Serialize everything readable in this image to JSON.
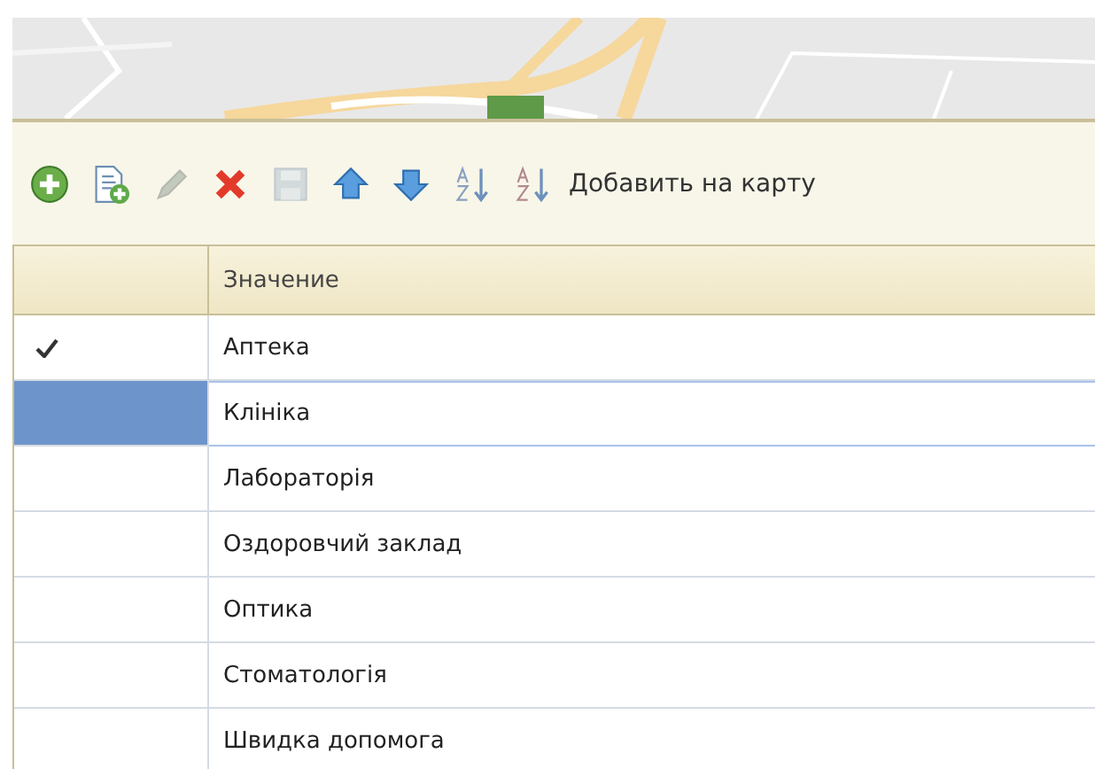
{
  "toolbar": {
    "buttons": [
      {
        "kind": "add",
        "disabled": false
      },
      {
        "kind": "copy",
        "disabled": false
      },
      {
        "kind": "edit",
        "disabled": true
      },
      {
        "kind": "delete",
        "disabled": false
      },
      {
        "kind": "save",
        "disabled": true
      },
      {
        "kind": "up",
        "disabled": false
      },
      {
        "kind": "down",
        "disabled": false
      },
      {
        "kind": "sort-asc",
        "disabled": false
      },
      {
        "kind": "sort-desc",
        "disabled": false
      }
    ],
    "action": "Добавить на карту"
  },
  "table": {
    "columns": [
      "Значение"
    ],
    "rows": [
      {
        "value": "Аптека",
        "marked": true,
        "selected": false
      },
      {
        "value": "Клініка",
        "marked": false,
        "selected": true
      },
      {
        "value": "Лабораторія",
        "marked": false,
        "selected": false
      },
      {
        "value": "Оздоровчий заклад",
        "marked": false,
        "selected": false
      },
      {
        "value": "Оптика",
        "marked": false,
        "selected": false
      },
      {
        "value": "Стоматологія",
        "marked": false,
        "selected": false
      },
      {
        "value": "Швидка допомога",
        "marked": false,
        "selected": false
      }
    ]
  }
}
